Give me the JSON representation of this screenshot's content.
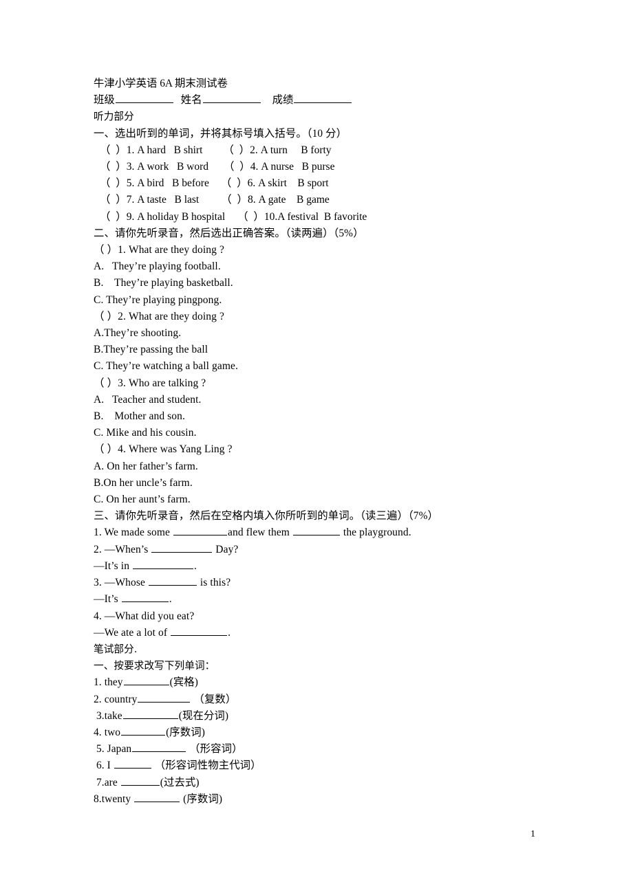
{
  "document": {
    "title": "牛津小学英语 6A 期末测试卷",
    "info_line": {
      "class_label": "班级",
      "name_label": "姓名",
      "score_label": "成绩"
    },
    "page_number": "1"
  },
  "listening": {
    "heading": "听力部分",
    "section1": {
      "heading": "一、选出听到的单词，并将其标号填入括号。（10 分）",
      "rows": [
        {
          "left": "（  ）1. A hard   B shirt",
          "right": "（  ）2. A turn     B forty"
        },
        {
          "left": "（  ）3. A work   B word",
          "right": "（  ）4. A nurse   B purse"
        },
        {
          "left": "（  ）5. A bird   B before",
          "right": "（  ）6. A skirt    B sport"
        },
        {
          "left": "（  ）7. A taste   B last",
          "right": "（  ）8. A gate    B game"
        },
        {
          "left": "（  ）9. A holiday B hospital",
          "right": "（  ）10.A festival  B favorite"
        }
      ]
    },
    "section2": {
      "heading": "二、请你先听录音，然后选出正确答案。（读两遍）（5%）",
      "questions": [
        {
          "stem": "（ ）1. What are they doing ?",
          "options": [
            "A.   They’re playing football.",
            "B.    They’re playing basketball.",
            "C. They’re playing pingpong."
          ]
        },
        {
          "stem": "（ ）2. What are they doing ?",
          "options": [
            "A.They’re shooting.",
            "B.They’re passing the ball",
            "C. They’re watching a ball game."
          ]
        },
        {
          "stem": "（ ）3. Who are talking ?",
          "options": [
            "A.   Teacher and student.",
            "B.    Mother and son.",
            "C. Mike and his cousin."
          ]
        },
        {
          "stem": "（ ）4. Where was Yang Ling ?",
          "options": [
            "A. On her father’s farm.",
            "B.On her uncle’s farm.",
            "C. On her aunt’s farm."
          ]
        }
      ]
    },
    "section3": {
      "heading": "三、请你先听录音，然后在空格内填入你所听到的单词。（读三遍）（7%）",
      "items": [
        {
          "pre": "1. We made some ",
          "mid": "and flew them ",
          "post": " the playground."
        },
        {
          "pre": "2. —When’s ",
          "post": " Day?"
        },
        {
          "pre": "—It’s in ",
          "post": "."
        },
        {
          "pre": "3. —Whose ",
          "post": " is this?"
        },
        {
          "pre": "—It’s ",
          "post": "."
        },
        {
          "pre": "4. —What did you eat?",
          "post": ""
        },
        {
          "pre": "—We ate a lot of ",
          "post": "."
        }
      ]
    }
  },
  "written": {
    "heading": "笔试部分.",
    "section1": {
      "heading": "一、按要求改写下列单词：",
      "items": [
        {
          "word": "1. they",
          "note": "(宾格)"
        },
        {
          "word": "2. country",
          "note": " （复数）"
        },
        {
          "word": " 3.take",
          "note": "(现在分词)"
        },
        {
          "word": "4. two",
          "note": "(序数词)"
        },
        {
          "word": " 5. Japan",
          "note": " （形容词）"
        },
        {
          "word": " 6. I ",
          "note": " （形容词性物主代词）"
        },
        {
          "word": " 7.are ",
          "note": "(过去式)"
        },
        {
          "word": "8.twenty ",
          "note": " (序数词)"
        }
      ]
    }
  }
}
